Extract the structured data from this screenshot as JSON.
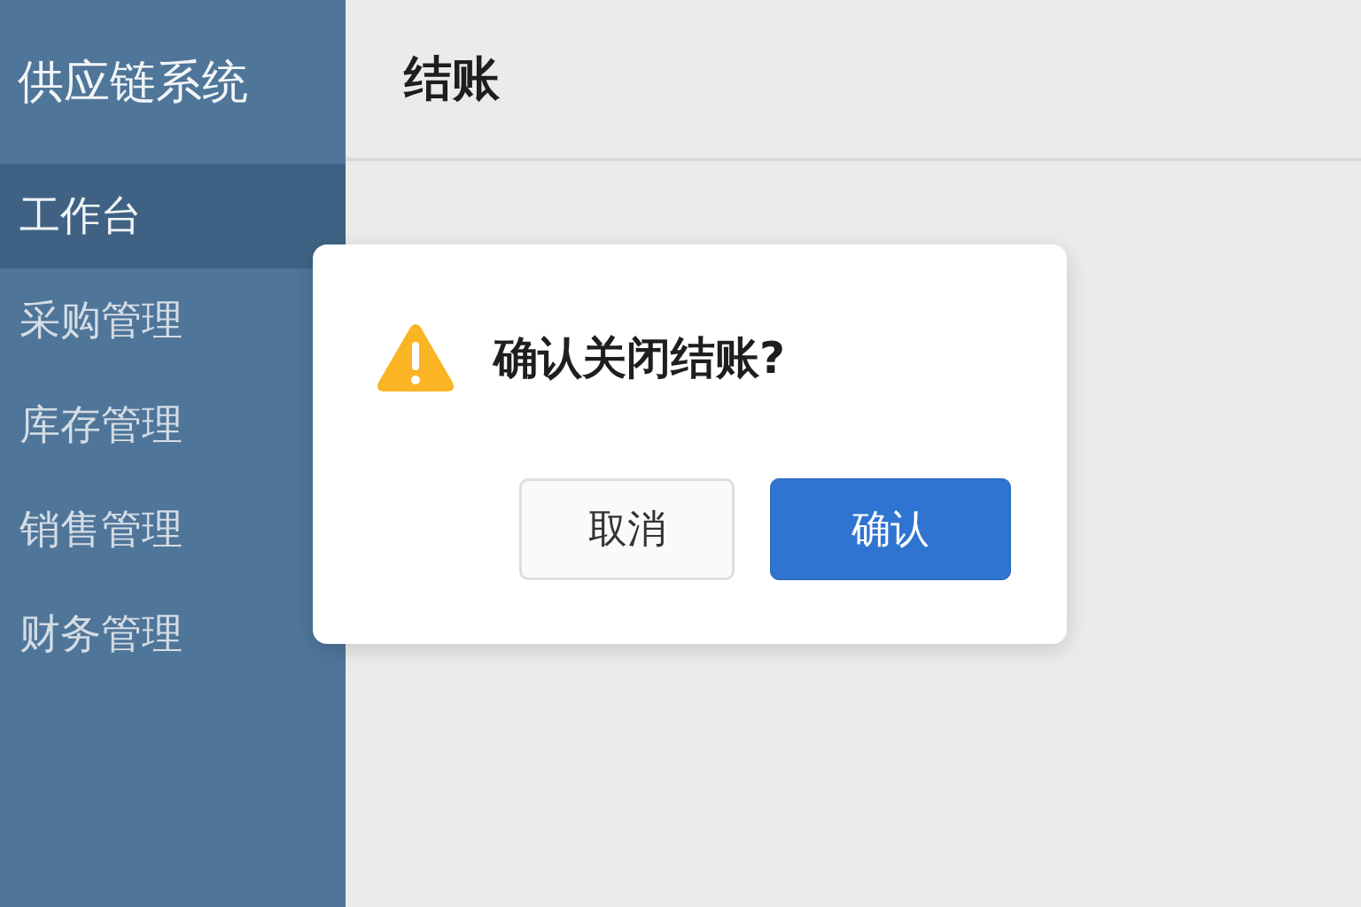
{
  "sidebar": {
    "title": "供应链系统",
    "items": [
      {
        "label": "工作台",
        "selected": true
      },
      {
        "label": "采购管理",
        "selected": false
      },
      {
        "label": "库存管理",
        "selected": false
      },
      {
        "label": "销售管理",
        "selected": false
      },
      {
        "label": "财务管理",
        "selected": false
      }
    ]
  },
  "header": {
    "title": "结账"
  },
  "dialog": {
    "message": "确认关闭结账?",
    "buttons": [
      {
        "label": "取消",
        "kind": "secondary"
      },
      {
        "label": "确认",
        "kind": "primary"
      }
    ]
  }
}
